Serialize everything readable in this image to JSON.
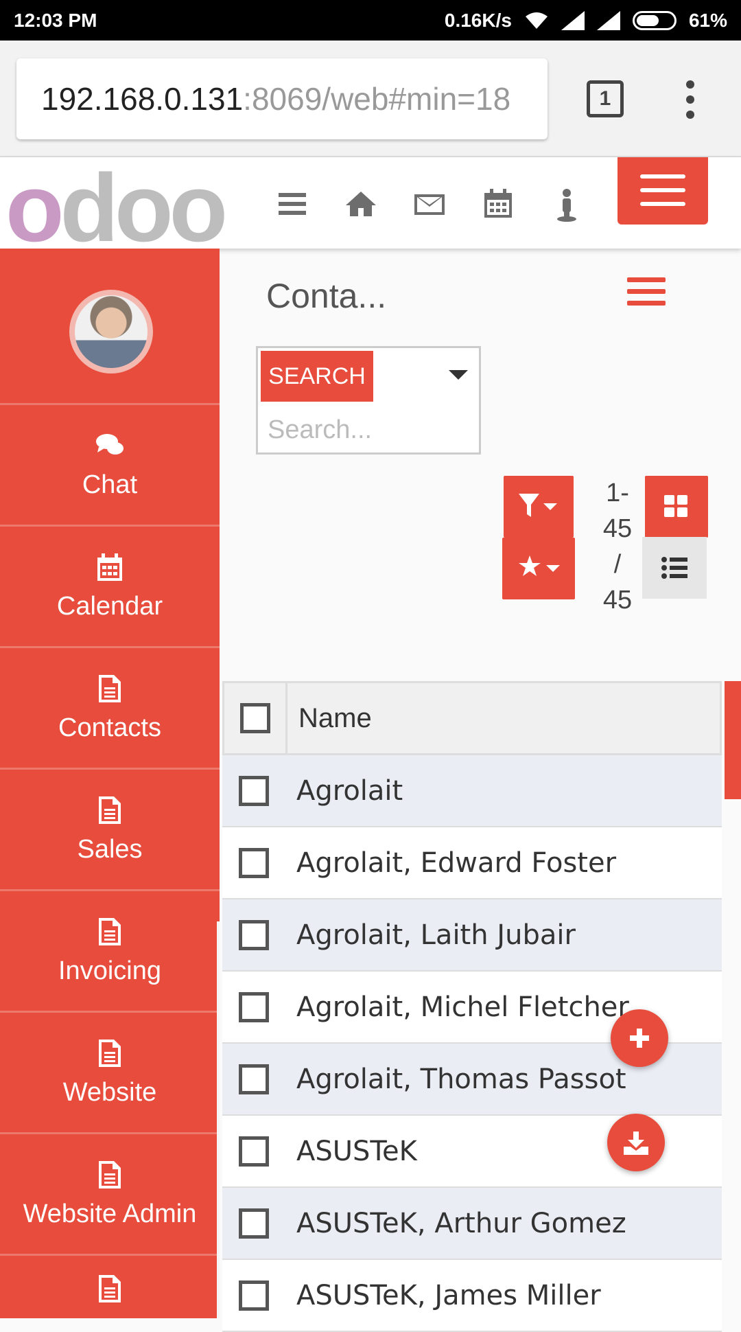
{
  "status_bar": {
    "time": "12:03 PM",
    "network_speed": "0.16K/s",
    "battery_percent": "61%",
    "battery_level": 0.61
  },
  "browser": {
    "url_host": "192.168.0.131",
    "url_path": ":8069/web#min=18",
    "tab_count": "1"
  },
  "header": {
    "logo_text": "odoo",
    "icons": [
      "menu-icon",
      "home-icon",
      "mail-icon",
      "calendar-icon",
      "user-icon"
    ],
    "accent": "#e74c3c"
  },
  "sidebar": {
    "items": [
      {
        "label": "Chat",
        "icon": "chat-icon"
      },
      {
        "label": "Calendar",
        "icon": "calendar-icon"
      },
      {
        "label": "Contacts",
        "icon": "document-icon"
      },
      {
        "label": "Sales",
        "icon": "document-icon"
      },
      {
        "label": "Invoicing",
        "icon": "document-icon"
      },
      {
        "label": "Website",
        "icon": "document-icon"
      },
      {
        "label": "Website Admin",
        "icon": "document-icon"
      },
      {
        "label": "",
        "icon": "document-icon"
      }
    ]
  },
  "main": {
    "title": "Conta...",
    "search": {
      "button_label": "SEARCH",
      "placeholder": "Search..."
    },
    "pager": {
      "line1": "1-",
      "line2": "45",
      "line3": "/",
      "line4": "45"
    },
    "table": {
      "header_name": "Name",
      "rows": [
        "Agrolait",
        "Agrolait, Edward Foster",
        "Agrolait, Laith Jubair",
        "Agrolait, Michel Fletcher",
        "Agrolait, Thomas Passot",
        "ASUSTeK",
        "ASUSTeK, Arthur Gomez",
        "ASUSTeK, James Miller"
      ]
    }
  }
}
